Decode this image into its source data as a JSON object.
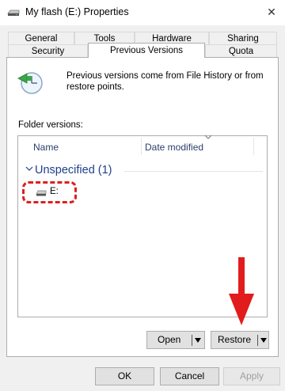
{
  "window": {
    "title": "My flash (E:) Properties",
    "close_glyph": "✕"
  },
  "tabs": {
    "row1": [
      "General",
      "Tools",
      "Hardware",
      "Sharing"
    ],
    "row2": [
      "Security",
      "Previous Versions",
      "Quota"
    ],
    "active": "Previous Versions"
  },
  "info": {
    "text": "Previous versions come from File History or from restore points."
  },
  "folder_versions": {
    "label": "Folder versions:",
    "columns": {
      "name": "Name",
      "date_modified": "Date modified"
    },
    "group": {
      "label": "Unspecified (1)"
    },
    "items": [
      {
        "name": "E:"
      }
    ]
  },
  "buttons": {
    "open": "Open",
    "restore": "Restore",
    "ok": "OK",
    "cancel": "Cancel",
    "apply": "Apply"
  },
  "colors": {
    "annotation_red": "#dd1f1f",
    "group_blue": "#1e3f8b"
  },
  "icons": [
    "drive-icon",
    "history-restore-icon",
    "close-icon",
    "chevron-down-icon"
  ]
}
